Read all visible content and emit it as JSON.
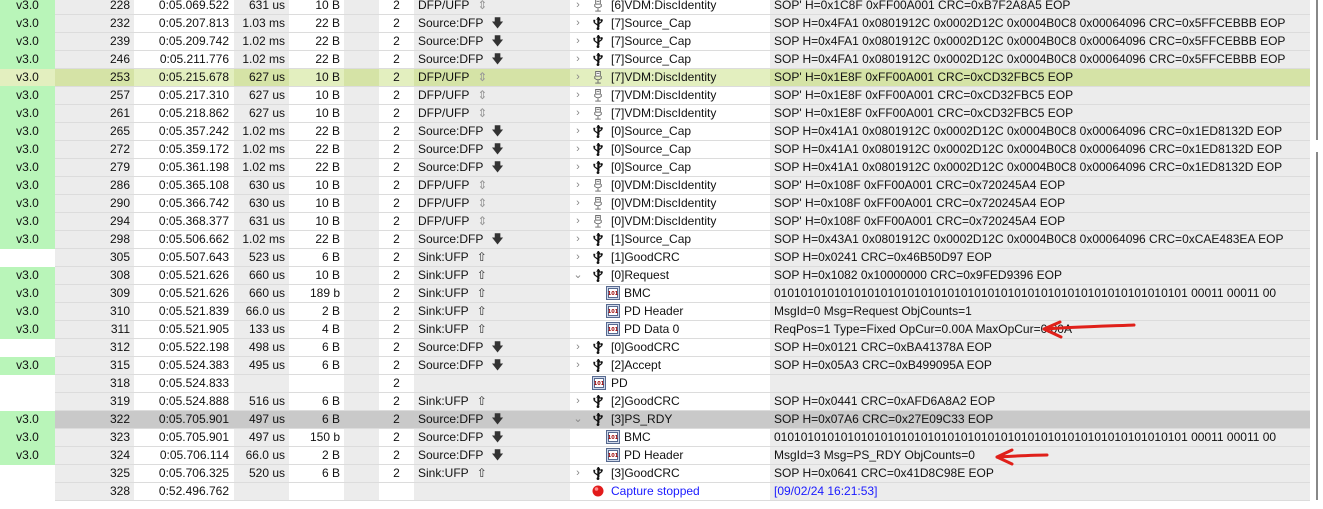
{
  "colors": {
    "version_bg": "#b9f5b9",
    "highlight": "#e3efbf",
    "selected": "#c9c9c9",
    "annotation": "#e0201a",
    "link": "#1a1aff"
  },
  "rows": [
    {
      "ver": "v3.0",
      "idx": "228",
      "time": "0:05.069.522",
      "dur": "631 us",
      "size": "10 B",
      "ch": "2",
      "role": "DFP/UFP",
      "arrow": "updown",
      "exp": ">",
      "icon": "plug",
      "name": "[6]VDM:DiscIdentity",
      "data": "SOP' H=0x1C8F 0xFF00A001 CRC=0xB7F2A8A5 EOP"
    },
    {
      "ver": "v3.0",
      "idx": "232",
      "time": "0:05.207.813",
      "dur": "1.03 ms",
      "size": "22 B",
      "ch": "2",
      "role": "Source:DFP",
      "arrow": "down",
      "exp": ">",
      "icon": "usb",
      "name": "[7]Source_Cap",
      "data": "SOP H=0x4FA1 0x0801912C 0x0002D12C 0x0004B0C8 0x00064096 CRC=0x5FFCEBBB EOP"
    },
    {
      "ver": "v3.0",
      "idx": "239",
      "time": "0:05.209.742",
      "dur": "1.02 ms",
      "size": "22 B",
      "ch": "2",
      "role": "Source:DFP",
      "arrow": "down",
      "exp": ">",
      "icon": "usb",
      "name": "[7]Source_Cap",
      "data": "SOP H=0x4FA1 0x0801912C 0x0002D12C 0x0004B0C8 0x00064096 CRC=0x5FFCEBBB EOP"
    },
    {
      "ver": "v3.0",
      "idx": "246",
      "time": "0:05.211.776",
      "dur": "1.02 ms",
      "size": "22 B",
      "ch": "2",
      "role": "Source:DFP",
      "arrow": "down",
      "exp": ">",
      "icon": "usb",
      "name": "[7]Source_Cap",
      "data": "SOP H=0x4FA1 0x0801912C 0x0002D12C 0x0004B0C8 0x00064096 CRC=0x5FFCEBBB EOP"
    },
    {
      "ver": "v3.0",
      "idx": "253",
      "time": "0:05.215.678",
      "dur": "627 us",
      "size": "10 B",
      "ch": "2",
      "role": "DFP/UFP",
      "arrow": "updown",
      "exp": ">",
      "icon": "plug",
      "name": "[7]VDM:DiscIdentity",
      "data": "SOP' H=0x1E8F 0xFF00A001 CRC=0xCD32FBC5 EOP",
      "state": "hl"
    },
    {
      "ver": "v3.0",
      "idx": "257",
      "time": "0:05.217.310",
      "dur": "627 us",
      "size": "10 B",
      "ch": "2",
      "role": "DFP/UFP",
      "arrow": "updown",
      "exp": ">",
      "icon": "plug",
      "name": "[7]VDM:DiscIdentity",
      "data": "SOP' H=0x1E8F 0xFF00A001 CRC=0xCD32FBC5 EOP"
    },
    {
      "ver": "v3.0",
      "idx": "261",
      "time": "0:05.218.862",
      "dur": "627 us",
      "size": "10 B",
      "ch": "2",
      "role": "DFP/UFP",
      "arrow": "updown",
      "exp": ">",
      "icon": "plug",
      "name": "[7]VDM:DiscIdentity",
      "data": "SOP' H=0x1E8F 0xFF00A001 CRC=0xCD32FBC5 EOP"
    },
    {
      "ver": "v3.0",
      "idx": "265",
      "time": "0:05.357.242",
      "dur": "1.02 ms",
      "size": "22 B",
      "ch": "2",
      "role": "Source:DFP",
      "arrow": "down",
      "exp": ">",
      "icon": "usb",
      "name": "[0]Source_Cap",
      "data": "SOP H=0x41A1 0x0801912C 0x0002D12C 0x0004B0C8 0x00064096 CRC=0x1ED8132D EOP"
    },
    {
      "ver": "v3.0",
      "idx": "272",
      "time": "0:05.359.172",
      "dur": "1.02 ms",
      "size": "22 B",
      "ch": "2",
      "role": "Source:DFP",
      "arrow": "down",
      "exp": ">",
      "icon": "usb",
      "name": "[0]Source_Cap",
      "data": "SOP H=0x41A1 0x0801912C 0x0002D12C 0x0004B0C8 0x00064096 CRC=0x1ED8132D EOP"
    },
    {
      "ver": "v3.0",
      "idx": "279",
      "time": "0:05.361.198",
      "dur": "1.02 ms",
      "size": "22 B",
      "ch": "2",
      "role": "Source:DFP",
      "arrow": "down",
      "exp": ">",
      "icon": "usb",
      "name": "[0]Source_Cap",
      "data": "SOP H=0x41A1 0x0801912C 0x0002D12C 0x0004B0C8 0x00064096 CRC=0x1ED8132D EOP"
    },
    {
      "ver": "v3.0",
      "idx": "286",
      "time": "0:05.365.108",
      "dur": "630 us",
      "size": "10 B",
      "ch": "2",
      "role": "DFP/UFP",
      "arrow": "updown",
      "exp": ">",
      "icon": "plug",
      "name": "[0]VDM:DiscIdentity",
      "data": "SOP' H=0x108F 0xFF00A001 CRC=0x720245A4 EOP"
    },
    {
      "ver": "v3.0",
      "idx": "290",
      "time": "0:05.366.742",
      "dur": "630 us",
      "size": "10 B",
      "ch": "2",
      "role": "DFP/UFP",
      "arrow": "updown",
      "exp": ">",
      "icon": "plug",
      "name": "[0]VDM:DiscIdentity",
      "data": "SOP' H=0x108F 0xFF00A001 CRC=0x720245A4 EOP"
    },
    {
      "ver": "v3.0",
      "idx": "294",
      "time": "0:05.368.377",
      "dur": "631 us",
      "size": "10 B",
      "ch": "2",
      "role": "DFP/UFP",
      "arrow": "updown",
      "exp": ">",
      "icon": "plug",
      "name": "[0]VDM:DiscIdentity",
      "data": "SOP' H=0x108F 0xFF00A001 CRC=0x720245A4 EOP"
    },
    {
      "ver": "v3.0",
      "idx": "298",
      "time": "0:05.506.662",
      "dur": "1.02 ms",
      "size": "22 B",
      "ch": "2",
      "role": "Source:DFP",
      "arrow": "down",
      "exp": ">",
      "icon": "usb",
      "name": "[1]Source_Cap",
      "data": "SOP H=0x43A1 0x0801912C 0x0002D12C 0x0004B0C8 0x00064096 CRC=0xCAE483EA EOP"
    },
    {
      "ver": "",
      "idx": "305",
      "time": "0:05.507.643",
      "dur": "523 us",
      "size": "6 B",
      "ch": "2",
      "role": "Sink:UFP",
      "arrow": "up",
      "exp": ">",
      "icon": "usb",
      "name": "[1]GoodCRC",
      "data": "SOP H=0x0241 CRC=0x46B50D97 EOP"
    },
    {
      "ver": "v3.0",
      "idx": "308",
      "time": "0:05.521.626",
      "dur": "660 us",
      "size": "10 B",
      "ch": "2",
      "role": "Sink:UFP",
      "arrow": "up",
      "exp": "v",
      "icon": "usb",
      "name": "[0]Request",
      "data": "SOP H=0x1082 0x10000000 CRC=0x9FED9396 EOP"
    },
    {
      "ver": "v3.0",
      "idx": "309",
      "time": "0:05.521.626",
      "dur": "660 us",
      "size": "189 b",
      "ch": "2",
      "role": "Sink:UFP",
      "arrow": "up",
      "exp": "",
      "icon": "bin",
      "child": true,
      "name": "BMC",
      "data": "01010101010101010101010101010101010101010101010101010101010101 00011 00011 00"
    },
    {
      "ver": "v3.0",
      "idx": "310",
      "time": "0:05.521.839",
      "dur": "66.0 us",
      "size": "2 B",
      "ch": "2",
      "role": "Sink:UFP",
      "arrow": "up",
      "exp": "",
      "icon": "bin",
      "child": true,
      "name": "PD Header",
      "data": "MsgId=0 Msg=Request ObjCounts=1"
    },
    {
      "ver": "v3.0",
      "idx": "311",
      "time": "0:05.521.905",
      "dur": "133 us",
      "size": "4 B",
      "ch": "2",
      "role": "Sink:UFP",
      "arrow": "up",
      "exp": "",
      "icon": "bin",
      "child": true,
      "name": "PD Data 0",
      "data": "ReqPos=1 Type=Fixed OpCur=0.00A MaxOpCur=0.00A"
    },
    {
      "ver": "",
      "idx": "312",
      "time": "0:05.522.198",
      "dur": "498 us",
      "size": "6 B",
      "ch": "2",
      "role": "Source:DFP",
      "arrow": "down",
      "exp": ">",
      "icon": "usb",
      "name": "[0]GoodCRC",
      "data": "SOP H=0x0121 CRC=0xBA41378A EOP"
    },
    {
      "ver": "v3.0",
      "idx": "315",
      "time": "0:05.524.383",
      "dur": "495 us",
      "size": "6 B",
      "ch": "2",
      "role": "Source:DFP",
      "arrow": "down",
      "exp": ">",
      "icon": "usb",
      "name": "[2]Accept",
      "data": "SOP H=0x05A3 CRC=0xB499095A EOP"
    },
    {
      "ver": "",
      "idx": "318",
      "time": "0:05.524.833",
      "dur": "",
      "size": "",
      "ch": "2",
      "role": "",
      "arrow": "",
      "exp": "",
      "icon": "bin",
      "name": "PD",
      "data": ""
    },
    {
      "ver": "",
      "idx": "319",
      "time": "0:05.524.888",
      "dur": "516 us",
      "size": "6 B",
      "ch": "2",
      "role": "Sink:UFP",
      "arrow": "up",
      "exp": ">",
      "icon": "usb",
      "name": "[2]GoodCRC",
      "data": "SOP H=0x0441 CRC=0xAFD6A8A2 EOP"
    },
    {
      "ver": "v3.0",
      "idx": "322",
      "time": "0:05.705.901",
      "dur": "497 us",
      "size": "6 B",
      "ch": "2",
      "role": "Source:DFP",
      "arrow": "down",
      "exp": "v",
      "icon": "usb",
      "name": "[3]PS_RDY",
      "data": "SOP H=0x07A6 CRC=0x27E09C33 EOP",
      "state": "sel"
    },
    {
      "ver": "v3.0",
      "idx": "323",
      "time": "0:05.705.901",
      "dur": "497 us",
      "size": "150 b",
      "ch": "2",
      "role": "Source:DFP",
      "arrow": "down",
      "exp": "",
      "icon": "bin",
      "child": true,
      "name": "BMC",
      "data": "01010101010101010101010101010101010101010101010101010101010101 00011 00011 00"
    },
    {
      "ver": "v3.0",
      "idx": "324",
      "time": "0:05.706.114",
      "dur": "66.0 us",
      "size": "2 B",
      "ch": "2",
      "role": "Source:DFP",
      "arrow": "down",
      "exp": "",
      "icon": "bin",
      "child": true,
      "name": "PD Header",
      "data": "MsgId=3 Msg=PS_RDY ObjCounts=0"
    },
    {
      "ver": "",
      "idx": "325",
      "time": "0:05.706.325",
      "dur": "520 us",
      "size": "6 B",
      "ch": "2",
      "role": "Sink:UFP",
      "arrow": "up",
      "exp": ">",
      "icon": "usb",
      "name": "[3]GoodCRC",
      "data": "SOP H=0x0641 CRC=0x41D8C98E EOP"
    },
    {
      "ver": "",
      "idx": "328",
      "time": "0:52.496.762",
      "dur": "",
      "size": "",
      "ch": "",
      "role": "",
      "arrow": "",
      "exp": "",
      "icon": "record",
      "name": "Capture stopped",
      "data": "[09/02/24 16:21:53]",
      "blue": true
    }
  ]
}
